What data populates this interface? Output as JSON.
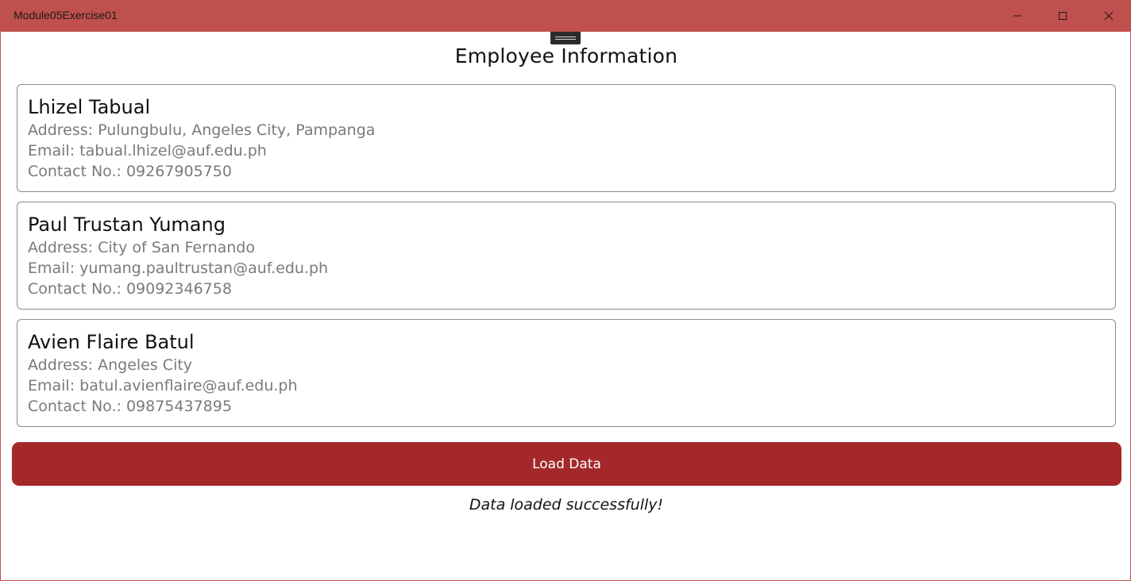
{
  "window": {
    "title": "Module05Exercise01",
    "accent_color": "#c0504d"
  },
  "page": {
    "title": "Employee Information"
  },
  "employees": [
    {
      "name": "Lhizel Tabual",
      "address": "Address: Pulungbulu, Angeles City, Pampanga",
      "email": "Email: tabual.lhizel@auf.edu.ph",
      "contact": "Contact No.: 09267905750"
    },
    {
      "name": "Paul Trustan Yumang",
      "address": "Address: City of San Fernando",
      "email": "Email: yumang.paultrustan@auf.edu.ph",
      "contact": "Contact No.: 09092346758"
    },
    {
      "name": "Avien Flaire Batul",
      "address": "Address: Angeles City",
      "email": "Email: batul.avienflaire@auf.edu.ph",
      "contact": "Contact No.: 09875437895"
    }
  ],
  "actions": {
    "load_label": "Load Data",
    "button_color": "#a4282a"
  },
  "status": {
    "message": "Data loaded successfully!"
  }
}
